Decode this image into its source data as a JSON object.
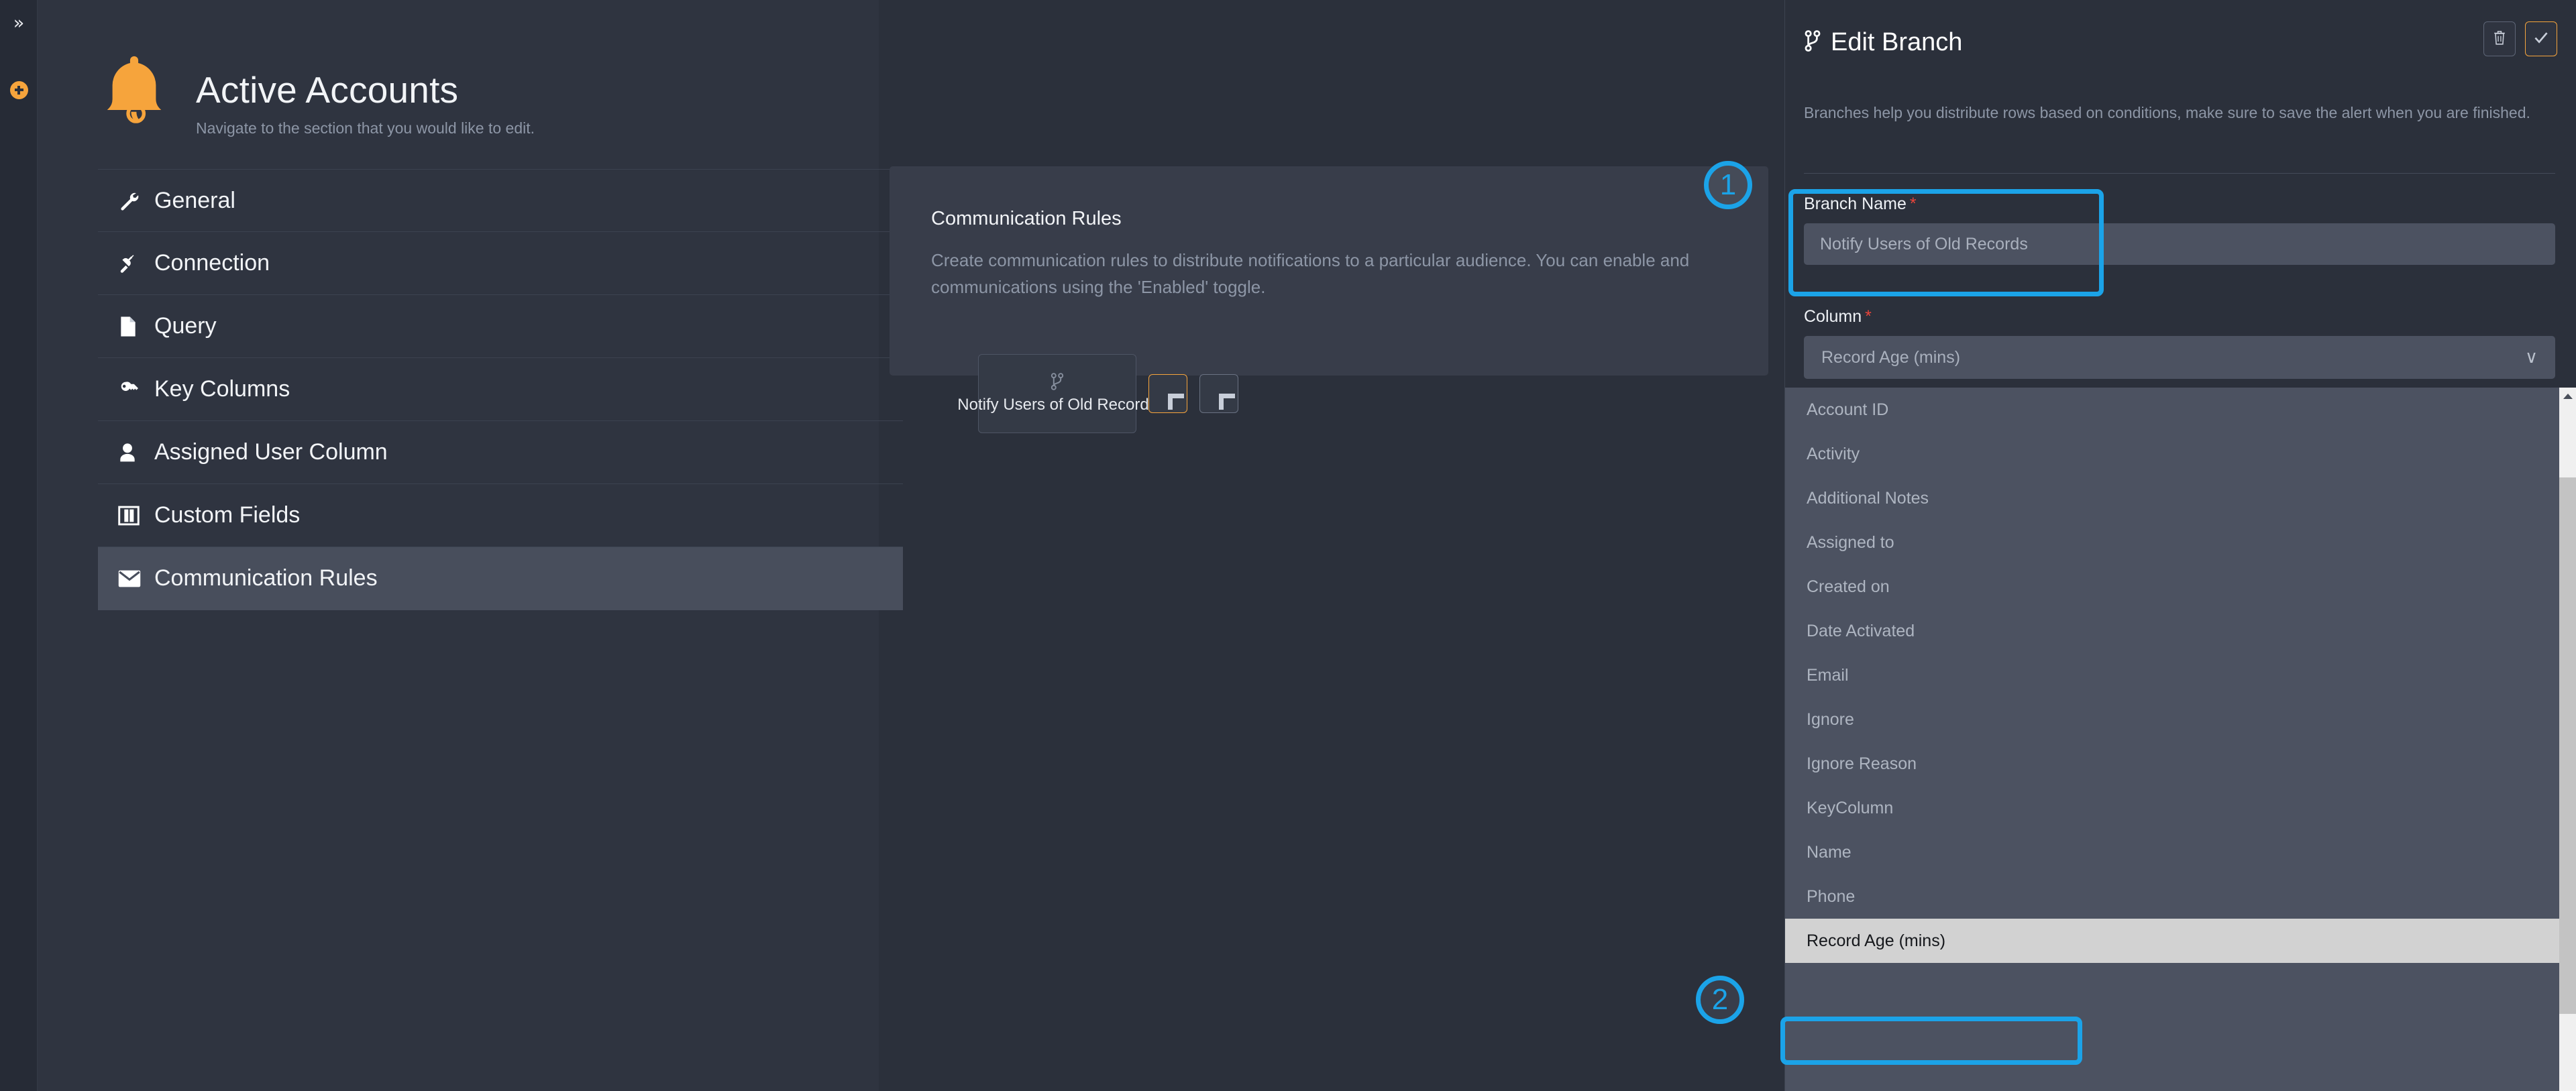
{
  "rail": {
    "expand_icon": "chevron-double-right-icon",
    "expand_glyph": "»",
    "add_icon": "add-circle-icon"
  },
  "left_panel": {
    "icon": "bell-icon",
    "title": "Active Accounts",
    "subtitle": "Navigate to the section that you would like to edit.",
    "nav_items": [
      {
        "label": "General",
        "icon": "wrench-icon",
        "active": false
      },
      {
        "label": "Connection",
        "icon": "plug-icon",
        "active": false
      },
      {
        "label": "Query",
        "icon": "file-icon",
        "active": false
      },
      {
        "label": "Key Columns",
        "icon": "key-icon",
        "active": false
      },
      {
        "label": "Assigned User Column",
        "icon": "user-icon",
        "active": false
      },
      {
        "label": "Custom Fields",
        "icon": "columns-icon",
        "active": false
      },
      {
        "label": "Communication Rules",
        "icon": "envelope-icon",
        "active": true
      }
    ]
  },
  "center_panel": {
    "title": "Communication Rules",
    "description": "Create communication rules to distribute notifications to a particular audience. You can enable and communications using the 'Enabled' toggle.",
    "branch_card": {
      "icon": "branch-icon",
      "label": "Notify Users of Old Records"
    },
    "add_branch_label": "+",
    "add_rule_label": "+"
  },
  "right_panel": {
    "icon": "branch-icon",
    "title": "Edit Branch",
    "delete_icon": "trash-icon",
    "confirm_icon": "check-icon",
    "description": "Branches help you distribute rows based on conditions, make sure to save the alert when you are finished.",
    "branch_name": {
      "label": "Branch Name",
      "required_marker": "*",
      "value": "Notify Users of Old Records",
      "placeholder": "Notify Users of Old Records"
    },
    "column": {
      "label": "Column",
      "required_marker": "*",
      "value": "Record Age (mins)",
      "chevron": "∨",
      "options": [
        "Account ID",
        "Activity",
        "Additional Notes",
        "Assigned to",
        "Created on",
        "Date Activated",
        "Email",
        "Ignore",
        "Ignore Reason",
        "KeyColumn",
        "Name",
        "Phone",
        "Record Age (mins)"
      ],
      "selected_option": "Record Age (mins)"
    }
  },
  "annotations": [
    {
      "number": "1",
      "target": "branch-name-field"
    },
    {
      "number": "2",
      "target": "record-age-option"
    }
  ],
  "colors": {
    "accent_orange": "#f6a43c",
    "annotation_blue": "#1ba3e8",
    "required_red": "#e8443a",
    "panel_bg": "#2f3440",
    "app_bg": "#2b303b"
  }
}
